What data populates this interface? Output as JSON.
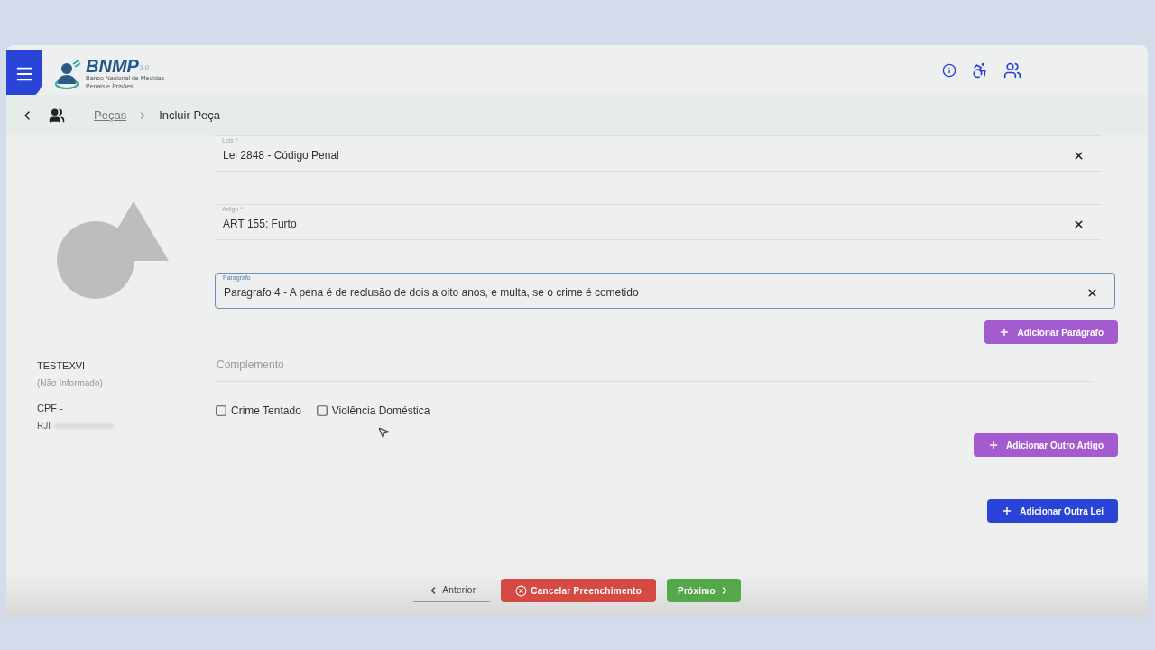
{
  "header": {
    "logo_text": "BNMP",
    "logo_version": "3.0",
    "logo_subtitle": "Banco Nacional de Medidas Penais e Prisões"
  },
  "breadcrumb": [
    {
      "label": "Peças",
      "link": true
    },
    {
      "label": "Incluir Peça",
      "link": false
    }
  ],
  "person": {
    "name": "TESTEXVI",
    "social_name": "(Não Informado)",
    "cpf_label": "CPF -",
    "rji_label": "RJI"
  },
  "fields": [
    {
      "label": "Leis *",
      "value": "Lei 2848 - Código Penal",
      "focused": false
    },
    {
      "label": "Artigo *",
      "value": "ART 155: Furto",
      "focused": false
    },
    {
      "label": "Paragrafo",
      "value": "Paragrafo 4 - A pena é de reclusão de dois a oito anos, e multa, se o crime é cometido",
      "focused": true
    }
  ],
  "add_paragraph": "Adicionar Parágrafo",
  "complemento": {
    "placeholder": "Complemento"
  },
  "checkboxes": [
    {
      "label": "Crime Tentado",
      "checked": false
    },
    {
      "label": "Violência Doméstica",
      "checked": false
    }
  ],
  "add_article": "Adicionar Outro Artigo",
  "add_law": "Adicionar Outra Lei",
  "footer": {
    "previous": "Anterior",
    "cancel": "Cancelar Preenchimento",
    "next": "Próximo"
  }
}
